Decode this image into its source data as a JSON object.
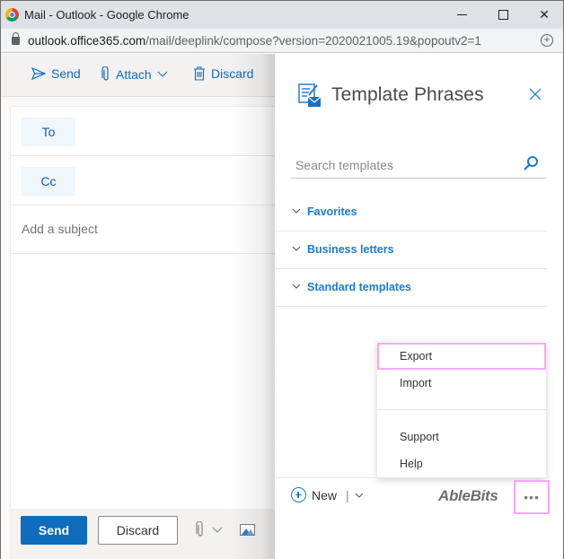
{
  "browser": {
    "title": "Mail - Outlook - Google Chrome",
    "url_host": "outlook.office365.com",
    "url_path": "/mail/deeplink/compose?version=2020021005.19&popoutv2=1"
  },
  "compose": {
    "toolbar": {
      "send_label": "Send",
      "attach_label": "Attach",
      "discard_label": "Discard"
    },
    "to_label": "To",
    "cc_label": "Cc",
    "subject_placeholder": "Add a subject",
    "footer": {
      "send_label": "Send",
      "discard_label": "Discard"
    }
  },
  "pane": {
    "title": "Template Phrases",
    "search_placeholder": "Search templates",
    "categories": [
      {
        "label": "Favorites"
      },
      {
        "label": "Business letters"
      },
      {
        "label": "Standard templates"
      }
    ],
    "menu": {
      "items": [
        {
          "label": "Export",
          "highlighted": true
        },
        {
          "label": "Import"
        },
        {
          "label": "Support"
        },
        {
          "label": "Help"
        }
      ]
    },
    "new_label": "New",
    "brand": "AbleBits",
    "more_label": "•••"
  },
  "colors": {
    "accent": "#0f6cbd",
    "pane_accent": "#1a7ad4",
    "highlight": "#f7a8f4"
  }
}
